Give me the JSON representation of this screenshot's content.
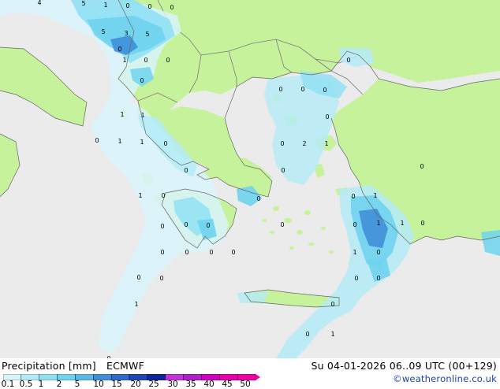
{
  "legend": {
    "title": "Precipitation [mm]",
    "model": "ECMWF",
    "validity": "Su 04-01-2026 06..09 UTC (00+129)",
    "credit": "©weatheronline.co.uk",
    "ticks": [
      "0.1",
      "0.5",
      "1",
      "2",
      "5",
      "10",
      "15",
      "20",
      "25",
      "30",
      "35",
      "40",
      "45",
      "50"
    ],
    "colors": [
      "#d8f4fb",
      "#b4ebf8",
      "#90e0f4",
      "#6fd3ef",
      "#5ab8e8",
      "#3f8fd8",
      "#2f6ac8",
      "#1f47b4",
      "#0f259a",
      "#c034d8",
      "#b020c8",
      "#d000c0",
      "#e800b0",
      "#f000a0"
    ]
  },
  "map": {
    "colors": {
      "sea": "#ebebeb",
      "land": "#c7f29c",
      "border": "#7a7a7a",
      "coast": "#666666"
    },
    "values": [
      "4",
      "5",
      "1",
      "0",
      "0",
      "0",
      "5",
      "3",
      "5",
      "0",
      "1",
      "0",
      "0",
      "0",
      "1",
      "1",
      "0",
      "1",
      "1",
      "0",
      "0",
      "0",
      "0",
      "0",
      "0",
      "2",
      "1",
      "0",
      "0",
      "0",
      "0",
      "1",
      "0",
      "1",
      "0",
      "0",
      "0",
      "0",
      "1",
      "1",
      "0",
      "0",
      "0",
      "0",
      "0",
      "0",
      "0",
      "1",
      "0",
      "0",
      "0",
      "0",
      "1",
      "0",
      "0",
      "1",
      "0",
      "0",
      "0"
    ]
  }
}
